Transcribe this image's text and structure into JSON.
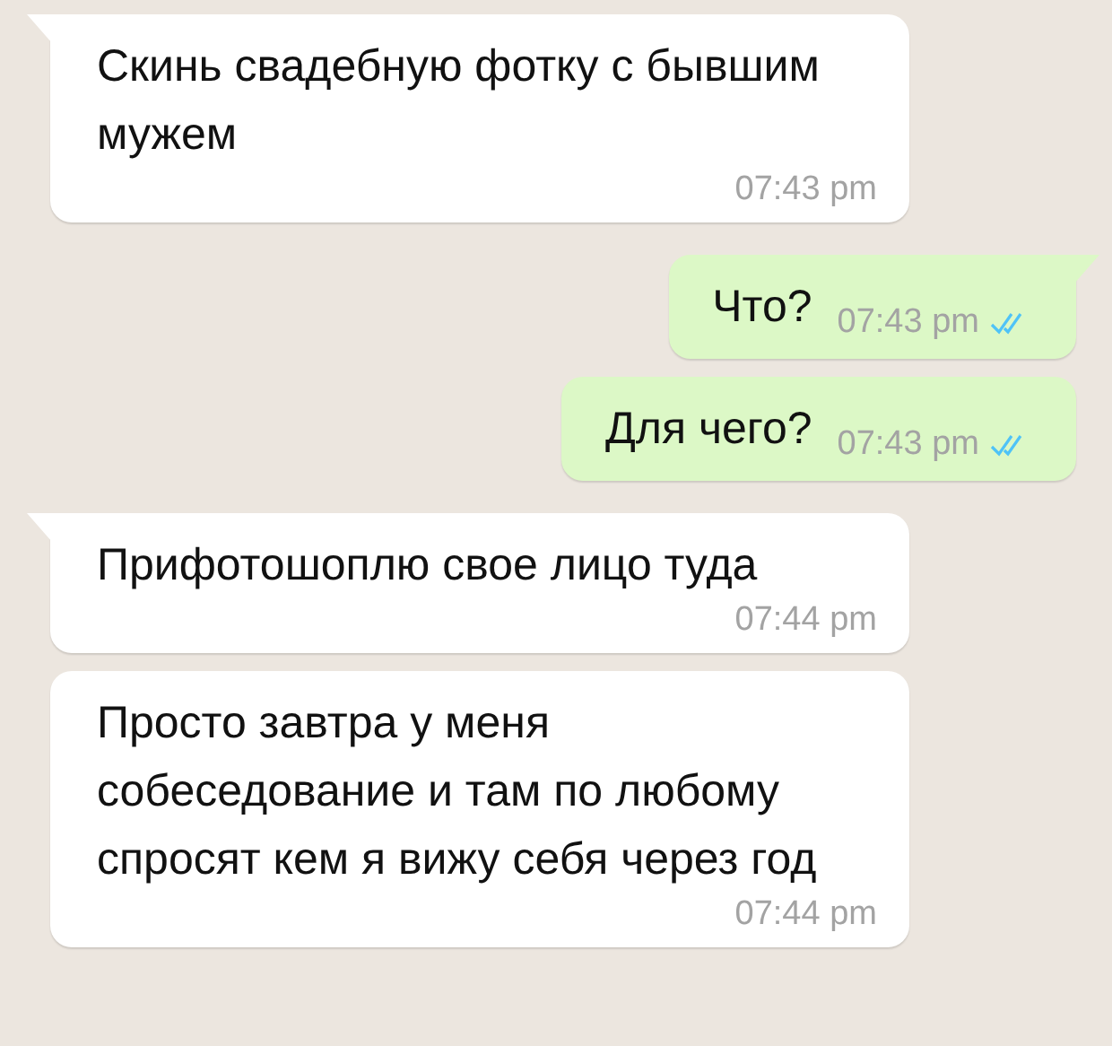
{
  "messages": [
    {
      "outgoing": false,
      "tail": true,
      "text": "Скинь свадебную фотку с бывшим мужем",
      "time": "07:43 pm"
    },
    {
      "outgoing": true,
      "tail": true,
      "text": "Что?",
      "time": "07:43 pm",
      "read": true
    },
    {
      "outgoing": true,
      "tail": false,
      "text": "Для чего?",
      "time": "07:43 pm",
      "read": true
    },
    {
      "outgoing": false,
      "tail": true,
      "text": "Прифотошоплю свое лицо туда",
      "time": "07:44 pm"
    },
    {
      "outgoing": false,
      "tail": false,
      "text": "Просто завтра у меня собеседование и там по любому спросят кем я вижу себя через год",
      "time": "07:44 pm"
    }
  ]
}
